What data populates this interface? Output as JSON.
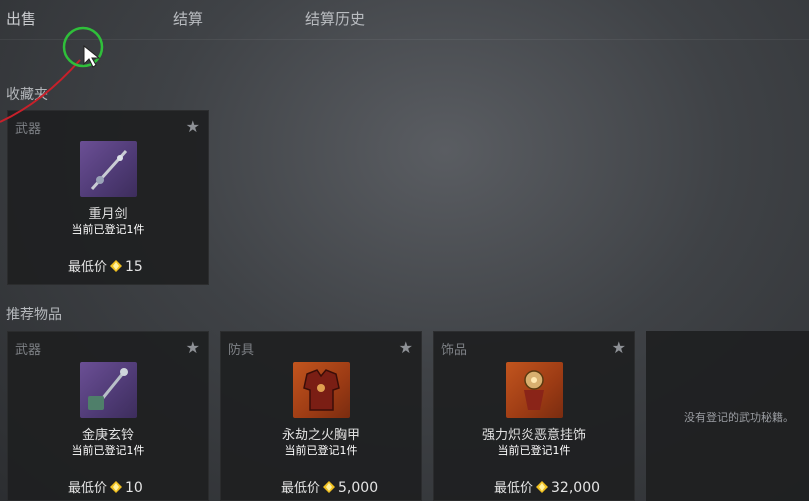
{
  "tabs": [
    "出售",
    "结算",
    "结算历史"
  ],
  "favorites": {
    "title": "收藏夹",
    "items": [
      {
        "category": "武器",
        "name": "重月剑",
        "registered": "当前已登记1件",
        "price_label": "最低价",
        "price": "15",
        "thumb": "sword-icon"
      }
    ]
  },
  "recommended": {
    "title": "推荐物品",
    "items": [
      {
        "category": "武器",
        "name": "金庚玄铃",
        "registered": "当前已登记1件",
        "price_label": "最低价",
        "price": "10",
        "thumb": "bell-icon"
      },
      {
        "category": "防具",
        "name": "永劫之火胸甲",
        "registered": "当前已登记1件",
        "price_label": "最低价",
        "price": "5,000",
        "thumb": "armor-icon"
      },
      {
        "category": "饰品",
        "name": "强力炽炎恶意挂饰",
        "registered": "当前已登记1件",
        "price_label": "最低价",
        "price": "32,000",
        "thumb": "pendant-icon"
      }
    ],
    "empty_message": "没有登记的武功秘籍。"
  },
  "colors": {
    "gem": "#f0c020",
    "highlight_ring": "#2fbf3a",
    "cursor_trail": "#c8202a"
  }
}
